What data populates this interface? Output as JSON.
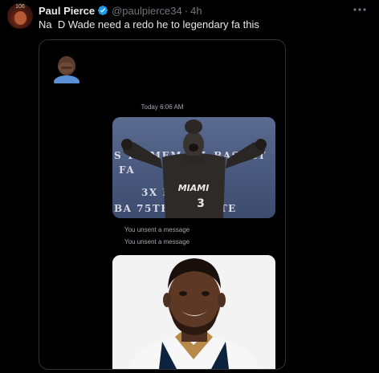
{
  "tweet": {
    "display_name": "Paul Pierce",
    "handle": "@paulpierce34",
    "separator": "·",
    "time": "4h",
    "text": "Na  D Wade need a redo he to legendary fa this",
    "avatar_text": "106",
    "verified_color": "#1d9bf0"
  },
  "screenshot": {
    "dm_timestamp": "Today 6:06 AM",
    "statue_plaque_lines": [
      "S  TH MEM  IAL BASKET",
      "  FA  ",
      "3X      PION",
      "BA 75TH     ISARY TE"
    ],
    "statue_jersey_text": "MIAMI",
    "statue_jersey_number": "3",
    "unsent_messages": [
      "You unsent a message",
      "You unsent a message"
    ],
    "background_color": "#000000"
  }
}
